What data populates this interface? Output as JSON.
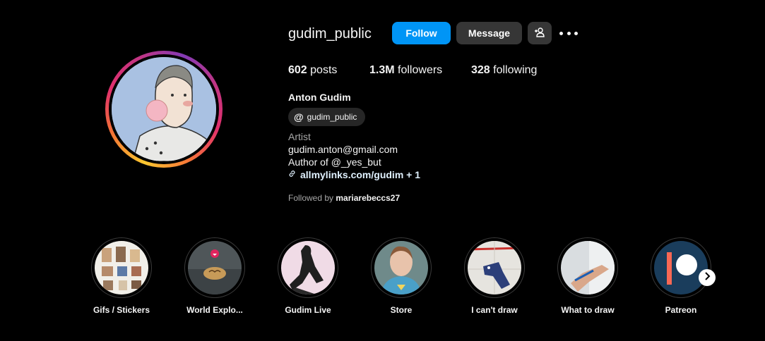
{
  "profile": {
    "username": "gudim_public",
    "follow_label": "Follow",
    "message_label": "Message",
    "posts_count": "602",
    "posts_label": "posts",
    "followers_count": "1.3M",
    "followers_label": "followers",
    "following_count": "328",
    "following_label": "following",
    "full_name": "Anton Gudim",
    "threads_handle": "gudim_public",
    "category": "Artist",
    "email": "gudim.anton@gmail.com",
    "author_line": "Author of @_yes_but",
    "link": "allmylinks.com/gudim + 1",
    "followed_by_prefix": "Followed by",
    "followed_by_user": "mariarebeccs27"
  },
  "highlights": [
    {
      "label": "Gifs / Stickers"
    },
    {
      "label": "World Explo..."
    },
    {
      "label": "Gudim Live"
    },
    {
      "label": "Store"
    },
    {
      "label": "I can't draw"
    },
    {
      "label": "What to draw"
    },
    {
      "label": "Patreon"
    }
  ],
  "colors": {
    "follow_button": "#0095f6",
    "secondary_button": "#363636",
    "background": "#000000",
    "link": "#e0f1ff"
  },
  "icons": {
    "add_user": "add-user-icon",
    "more": "more-options-icon",
    "threads": "threads-icon",
    "link": "link-icon",
    "next": "chevron-right-icon"
  }
}
